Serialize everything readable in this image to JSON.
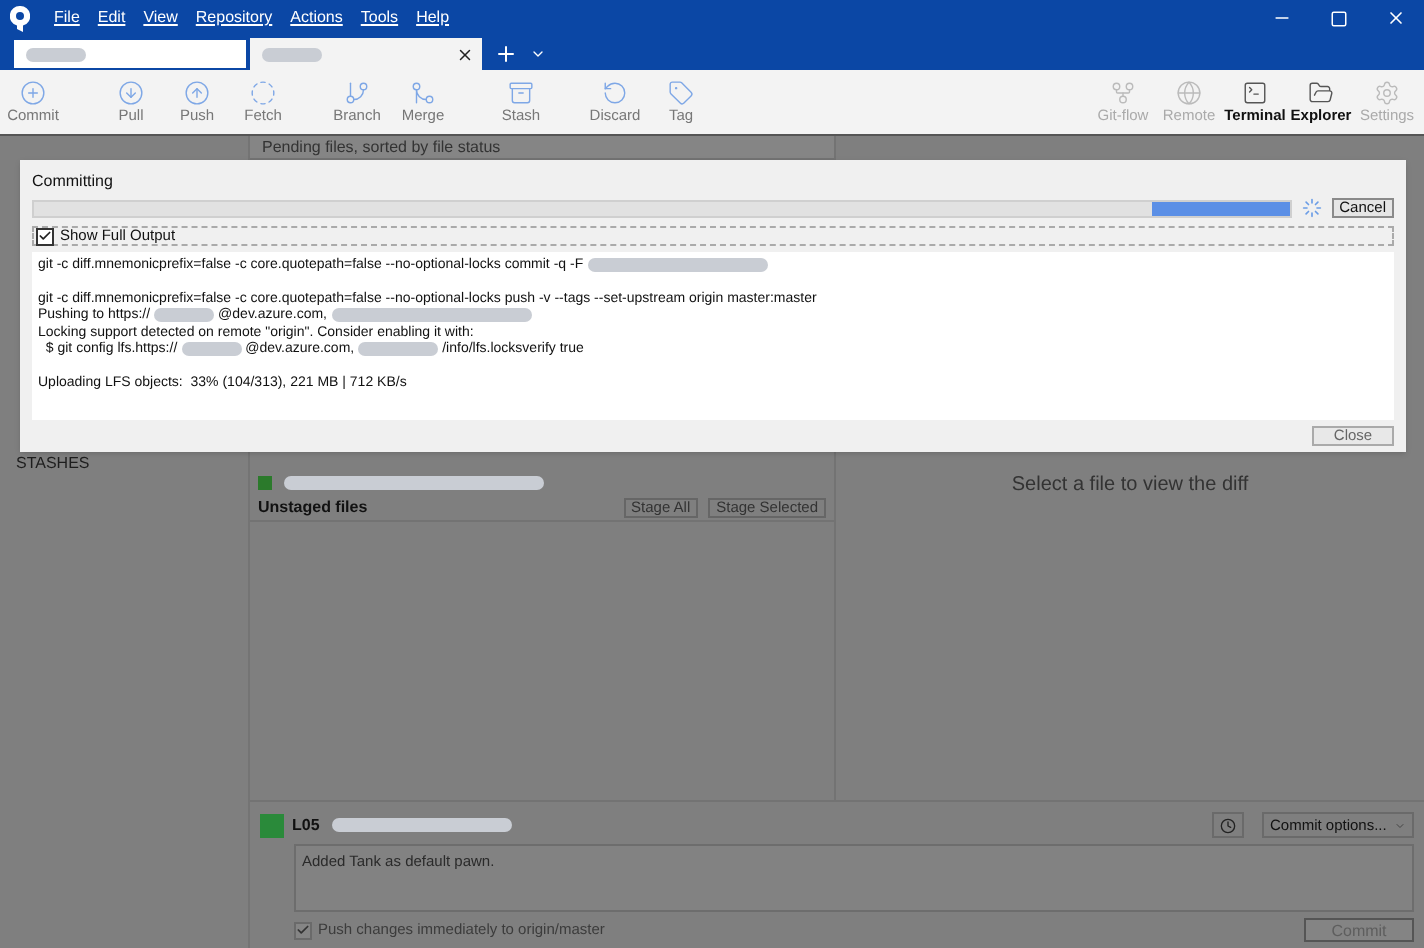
{
  "menu": [
    "File",
    "Edit",
    "View",
    "Repository",
    "Actions",
    "Tools",
    "Help"
  ],
  "tabs": [
    {
      "selected": false
    },
    {
      "selected": true
    }
  ],
  "toolbar": [
    {
      "label": "Commit",
      "kind": "action",
      "disabled": false
    },
    {
      "label": "Pull",
      "kind": "action",
      "disabled": false
    },
    {
      "label": "Push",
      "kind": "action",
      "disabled": false
    },
    {
      "label": "Fetch",
      "kind": "action",
      "disabled": false
    },
    {
      "label": "Branch",
      "kind": "action",
      "disabled": false
    },
    {
      "label": "Merge",
      "kind": "action",
      "disabled": false
    },
    {
      "label": "Stash",
      "kind": "action",
      "disabled": false
    },
    {
      "label": "Discard",
      "kind": "action",
      "disabled": false
    },
    {
      "label": "Tag",
      "kind": "action",
      "disabled": false
    },
    {
      "label": "Git-flow",
      "kind": "tool",
      "disabled": true
    },
    {
      "label": "Remote",
      "kind": "tool",
      "disabled": true
    },
    {
      "label": "Terminal",
      "kind": "tool",
      "disabled": false
    },
    {
      "label": "Explorer",
      "kind": "tool",
      "disabled": false
    },
    {
      "label": "Settings",
      "kind": "tool",
      "disabled": true
    }
  ],
  "file_list_header": "Pending files, sorted by file status",
  "sidebar": {
    "section": "STASHES"
  },
  "unstaged": {
    "title": "Unstaged files",
    "buttons": [
      "Stage All",
      "Stage Selected"
    ]
  },
  "diff_placeholder": "Select a file to view the diff",
  "commit": {
    "author": "L05",
    "message": "Added Tank as default pawn.",
    "options": "Commit options...",
    "push": {
      "label": "Push changes immediately to origin/master",
      "checked": true
    },
    "button": "Commit"
  },
  "dialog": {
    "title": "Committing",
    "cancel": "Cancel",
    "show_full_output": {
      "label": "Show Full Output",
      "checked": true
    },
    "close": "Close",
    "progress": {
      "level": 0.11
    },
    "log": [
      {
        "kind": "line",
        "parts": [
          {
            "kind": "text",
            "text": "git -c diff.mnemonicprefix=false -c core.quotepath=false --no-optional-locks commit -q -F"
          },
          {
            "kind": "blur"
          }
        ]
      },
      {
        "kind": "blank"
      },
      {
        "kind": "line",
        "parts": [
          {
            "kind": "text",
            "text": "git -c diff.mnemonicprefix=false -c core.quotepath=false --no-optional-locks push -v --tags --set-upstream origin master:master"
          }
        ]
      },
      {
        "kind": "line",
        "parts": [
          {
            "kind": "text",
            "text": "Pushing to https://"
          },
          {
            "kind": "blur"
          },
          {
            "kind": "text",
            "text": "@dev.azure.com,"
          },
          {
            "kind": "blur"
          }
        ]
      },
      {
        "kind": "line",
        "parts": [
          {
            "kind": "text",
            "text": "Locking support detected on remote \"origin\". Consider enabling it with:"
          }
        ]
      },
      {
        "kind": "line",
        "parts": [
          {
            "kind": "text",
            "text": "  $ git config lfs.https://"
          },
          {
            "kind": "blur"
          },
          {
            "kind": "text",
            "text": "@dev.azure.com,"
          },
          {
            "kind": "blur"
          },
          {
            "kind": "text",
            "text": "/info/lfs.locksverify true"
          }
        ]
      },
      {
        "kind": "blank"
      },
      {
        "kind": "line",
        "parts": [
          {
            "kind": "text",
            "text": "Uploading LFS objects:  33% (104/313), 221 MB | 712 KB/s"
          }
        ]
      }
    ]
  }
}
